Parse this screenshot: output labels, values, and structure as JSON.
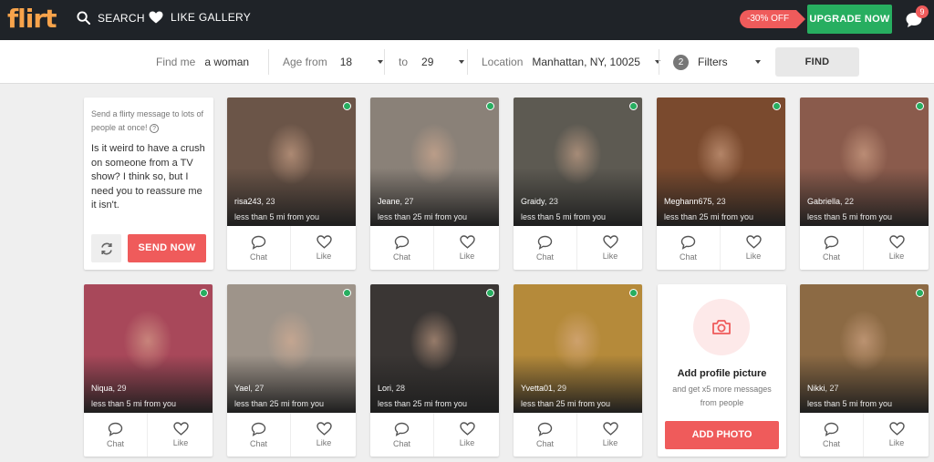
{
  "header": {
    "logo": "flirt",
    "search_label": "SEARCH",
    "like_gallery_label": "LIKE GALLERY",
    "discount_label": "-30% OFF",
    "upgrade_label": "UPGRADE NOW",
    "notification_count": "9"
  },
  "filters": {
    "find_label": "Find me",
    "find_value": "a woman",
    "age_from_label": "Age from",
    "age_from_value": "18",
    "age_to_label": "to",
    "age_to_value": "29",
    "location_label": "Location",
    "location_value": "Manhattan, NY, 10025",
    "filters_count": "2",
    "filters_label": "Filters",
    "find_button": "FIND"
  },
  "message_card": {
    "intro": "Send a flirty message to lots of people at once!",
    "text": "Is it weird to have a crush on someone from a TV show? I think so, but I need you to reassure me it isn't.",
    "send_label": "SEND NOW"
  },
  "action_labels": {
    "chat": "Chat",
    "like": "Like"
  },
  "profiles": [
    {
      "name": "risa243",
      "age": "23",
      "distance": "less than 5 mi from you",
      "photo_color": "#6b5548"
    },
    {
      "name": "Jeane",
      "age": "27",
      "distance": "less than 25 mi from you",
      "photo_color": "#8a8178"
    },
    {
      "name": "Graidy",
      "age": "23",
      "distance": "less than 5 mi from you",
      "photo_color": "#5d5a52"
    },
    {
      "name": "Meghann675",
      "age": "23",
      "distance": "less than 25 mi from you",
      "photo_color": "#7a4a2e"
    },
    {
      "name": "Gabriella",
      "age": "22",
      "distance": "less than 5 mi from you",
      "photo_color": "#8a5b4c"
    },
    {
      "name": "Niqua",
      "age": "29",
      "distance": "less than 5 mi from you",
      "photo_color": "#a8485a"
    },
    {
      "name": "Yael",
      "age": "27",
      "distance": "less than 25 mi from you",
      "photo_color": "#9e948a"
    },
    {
      "name": "Lori",
      "age": "28",
      "distance": "less than 25 mi from you",
      "photo_color": "#3a3634"
    },
    {
      "name": "Yvetta01",
      "age": "29",
      "distance": "less than 25 mi from you",
      "photo_color": "#b58a3a"
    },
    {
      "name": "Nikki",
      "age": "27",
      "distance": "less than 5 mi from you",
      "photo_color": "#8c6a44"
    }
  ],
  "add_photo_card": {
    "title": "Add profile picture",
    "subtitle": "and get x5 more messages from people",
    "button": "ADD PHOTO"
  },
  "colors": {
    "accent": "#ef5b5b",
    "upgrade": "#27ae60",
    "online": "#27ae60",
    "topbar": "#1f2328",
    "logo": "#f7a34b"
  }
}
